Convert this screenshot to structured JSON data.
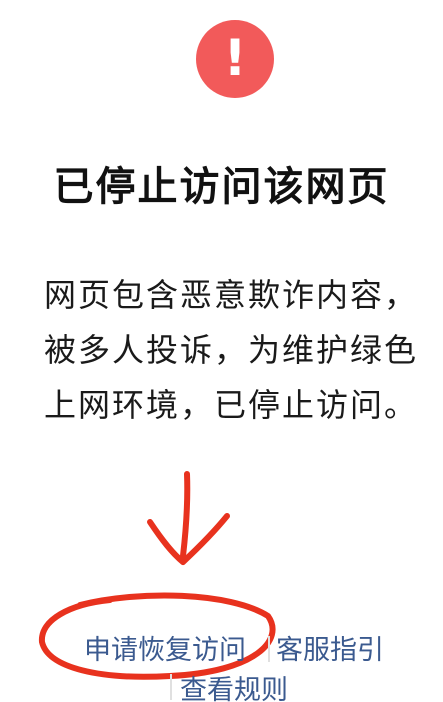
{
  "icon": {
    "name": "alert-exclamation-icon",
    "glyph": "!",
    "color": "#f25a5a"
  },
  "title": "已停止访问该网页",
  "description": [
    "网页包含恶意欺诈内容，",
    "被多人投诉，为维护绿色",
    "上网环境，已停止访问。"
  ],
  "links": {
    "apply_restore": "申请恢复访问",
    "service_guide": "客服指引",
    "view_rules": "查看规则",
    "color": "#3b5a8f"
  },
  "annotation_color": "#e8321e"
}
